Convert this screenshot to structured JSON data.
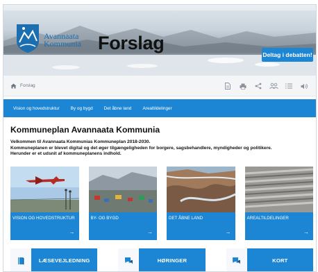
{
  "header": {
    "logo_text_line1": "Avannaata",
    "logo_text_line2": "Kommunia",
    "title": "Forslag",
    "debate_button": "Deltag i debatten!"
  },
  "breadcrumb": {
    "home_icon": "home-icon",
    "current": "Forslag"
  },
  "toolbar": {
    "icons": [
      "document-icon",
      "print-icon",
      "share-icon",
      "users-icon",
      "list-icon",
      "speaker-icon"
    ]
  },
  "nav": {
    "items": [
      {
        "label": "Vision og hovedstruktur"
      },
      {
        "label": "By og bygd"
      },
      {
        "label": "Det åbne land"
      },
      {
        "label": "Arealtildelinger"
      }
    ]
  },
  "intro": {
    "heading": "Kommuneplan Avannaata Kommunia",
    "line1": "Velkommen til Avannaata Kommunias Kommuneplan 2018-2030.",
    "line2": "Kommuneplanen er blevet digital og det øger tilgængeligheden for borgere, sagsbehandlere, myndigheder og politikere.",
    "line3": "Herunder er et udsnit af kommuneplanens indhold."
  },
  "cards": [
    {
      "title": "VISION OG HOVEDSTRUKTUR",
      "arrow": "→"
    },
    {
      "title": "BY- OG BYGD",
      "arrow": "→"
    },
    {
      "title": "DET ÅBNE LAND",
      "arrow": "→"
    },
    {
      "title": "AREALTILDELINGER",
      "arrow": "→"
    }
  ],
  "bottom_buttons": [
    {
      "label": "LÆSEVEJLEDNING",
      "icon": "book-icon"
    },
    {
      "label": "HØRINGER",
      "icon": "chat-icon"
    },
    {
      "label": "KORT",
      "icon": "chat-icon"
    }
  ],
  "colors": {
    "accent": "#1c86d4",
    "logo_blue": "#1b6fb0"
  }
}
